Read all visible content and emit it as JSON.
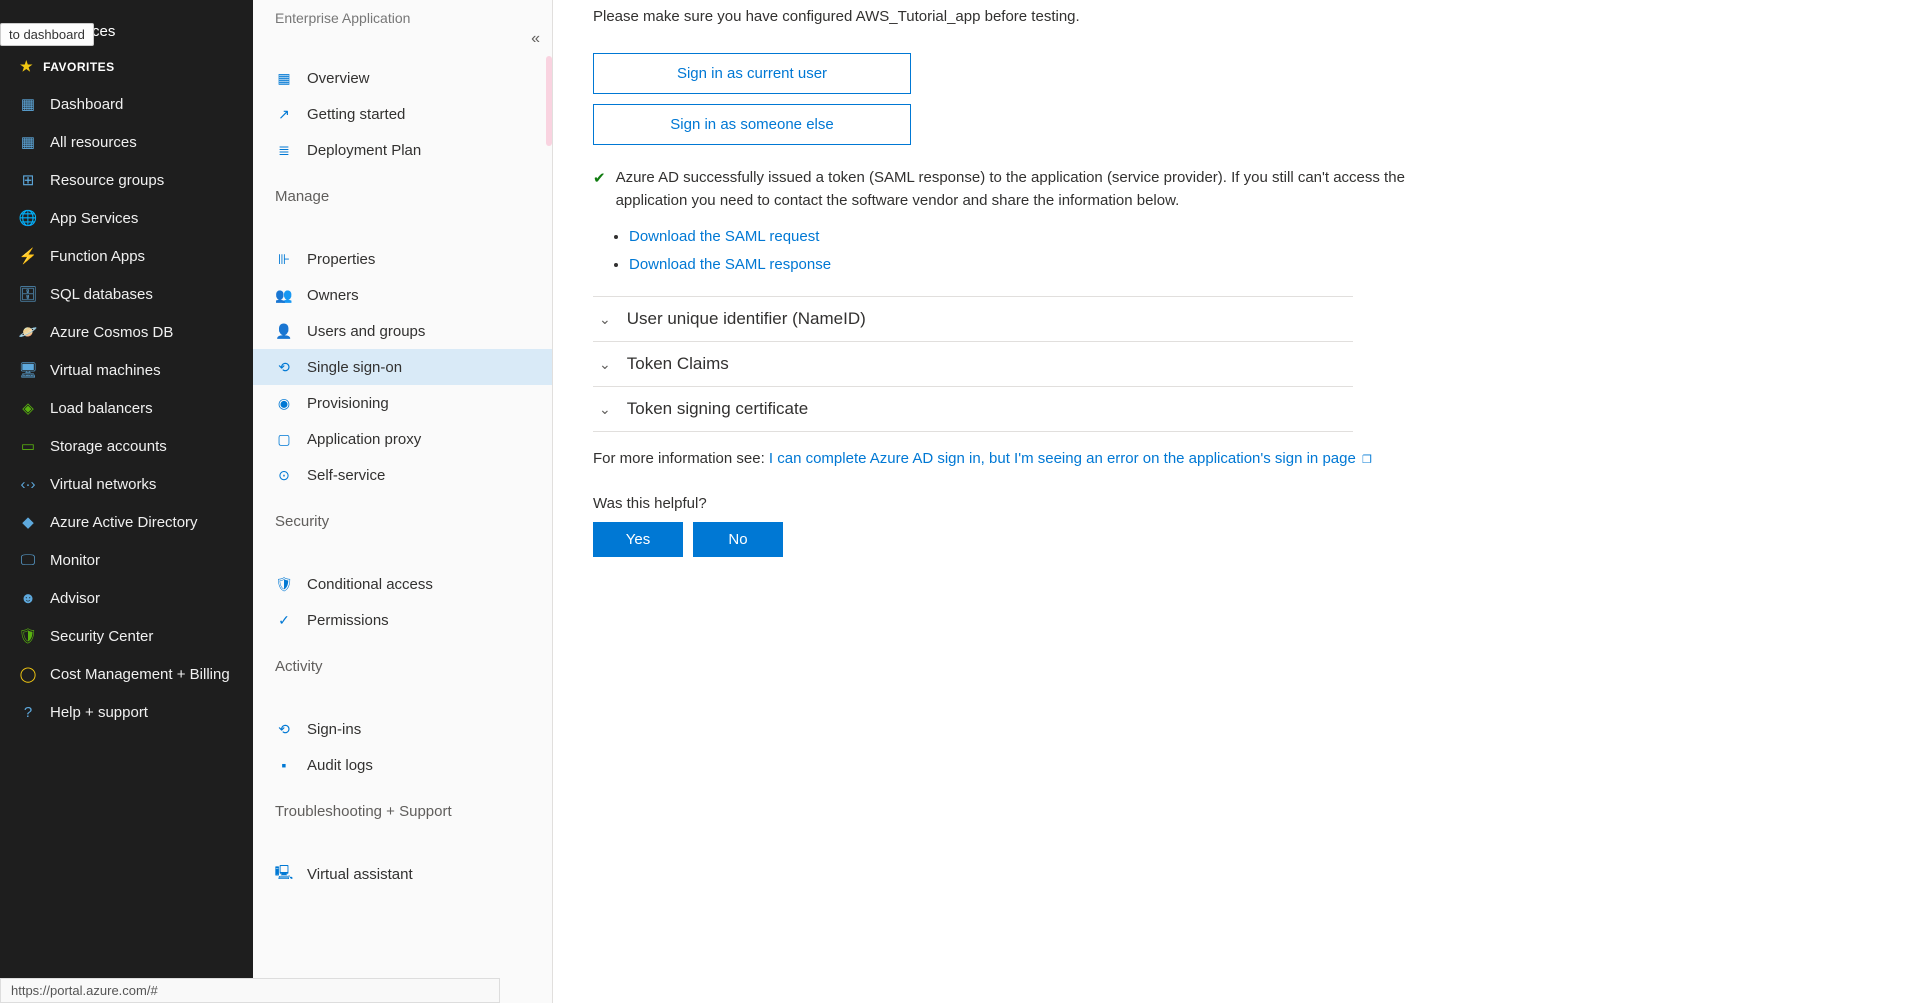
{
  "tooltip": "to dashboard",
  "extra_tab_text": "ces",
  "favorites_label": "FAVORITES",
  "left_nav": [
    {
      "icon": "▦",
      "label": "Dashboard",
      "color": "#5ea9dd"
    },
    {
      "icon": "▦",
      "label": "All resources",
      "color": "#5ea9dd"
    },
    {
      "icon": "⊞",
      "label": "Resource groups",
      "color": "#5ea9dd"
    },
    {
      "icon": "🌐",
      "label": "App Services",
      "color": "#5ea9dd"
    },
    {
      "icon": "⚡",
      "label": "Function Apps",
      "color": "#f2c811"
    },
    {
      "icon": "🗄",
      "label": "SQL databases",
      "color": "#5ea9dd"
    },
    {
      "icon": "🪐",
      "label": "Azure Cosmos DB",
      "color": "#5ea9dd"
    },
    {
      "icon": "🖥",
      "label": "Virtual machines",
      "color": "#5ea9dd"
    },
    {
      "icon": "◈",
      "label": "Load balancers",
      "color": "#59b210"
    },
    {
      "icon": "▭",
      "label": "Storage accounts",
      "color": "#59b210"
    },
    {
      "icon": "‹·›",
      "label": "Virtual networks",
      "color": "#5ea9dd"
    },
    {
      "icon": "◆",
      "label": "Azure Active Directory",
      "color": "#5ea9dd"
    },
    {
      "icon": "🖵",
      "label": "Monitor",
      "color": "#5ea9dd"
    },
    {
      "icon": "☻",
      "label": "Advisor",
      "color": "#5ea9dd"
    },
    {
      "icon": "🛡",
      "label": "Security Center",
      "color": "#59b210"
    },
    {
      "icon": "◯",
      "label": "Cost Management + Billing",
      "color": "#f2c811"
    },
    {
      "icon": "?",
      "label": "Help + support",
      "color": "#5ea9dd"
    }
  ],
  "mid_subtitle": "Enterprise Application",
  "mid_groups": [
    {
      "label": "",
      "items": [
        {
          "icon": "▦",
          "label": "Overview"
        },
        {
          "icon": "↗",
          "label": "Getting started"
        },
        {
          "icon": "≣",
          "label": "Deployment Plan"
        }
      ]
    },
    {
      "label": "Manage",
      "items": [
        {
          "icon": "⊪",
          "label": "Properties"
        },
        {
          "icon": "👥",
          "label": "Owners"
        },
        {
          "icon": "👤",
          "label": "Users and groups"
        },
        {
          "icon": "⟲",
          "label": "Single sign-on",
          "active": true
        },
        {
          "icon": "◉",
          "label": "Provisioning"
        },
        {
          "icon": "▢",
          "label": "Application proxy"
        },
        {
          "icon": "⊙",
          "label": "Self-service"
        }
      ]
    },
    {
      "label": "Security",
      "items": [
        {
          "icon": "🛡",
          "label": "Conditional access"
        },
        {
          "icon": "✓",
          "label": "Permissions"
        }
      ]
    },
    {
      "label": "Activity",
      "items": [
        {
          "icon": "⟲",
          "label": "Sign-ins"
        },
        {
          "icon": "▪",
          "label": "Audit logs"
        }
      ]
    },
    {
      "label": "Troubleshooting + Support",
      "items": [
        {
          "icon": "🖳",
          "label": "Virtual assistant"
        }
      ]
    }
  ],
  "main": {
    "notice": "Please make sure you have configured AWS_Tutorial_app before testing.",
    "btn_current": "Sign in as current user",
    "btn_other": "Sign in as someone else",
    "status": "Azure AD successfully issued a token (SAML response) to the application (service provider). If you still can't access the application you need to contact the software vendor and share the information below.",
    "downloads": [
      "Download the SAML request",
      "Download the SAML response"
    ],
    "accordion": [
      "User unique identifier (NameID)",
      "Token Claims",
      "Token signing certificate"
    ],
    "more_prefix": "For more information see: ",
    "more_link": "I can complete Azure AD sign in, but I'm seeing an error on the application's sign in page",
    "helpful_q": "Was this helpful?",
    "yes": "Yes",
    "no": "No"
  },
  "status_bar": "https://portal.azure.com/#"
}
